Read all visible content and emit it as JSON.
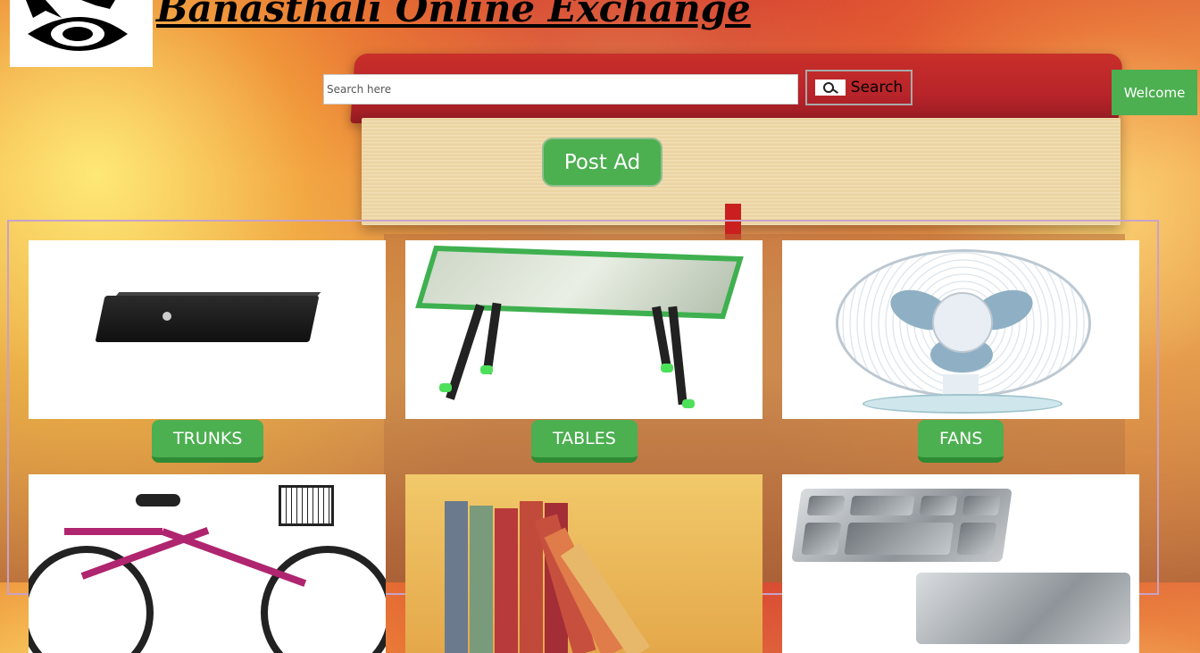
{
  "header": {
    "site_title": "Banasthali Online Exchange"
  },
  "search": {
    "placeholder": "Search here",
    "value": "",
    "button_label": "Search"
  },
  "user": {
    "welcome_label": "Welcome"
  },
  "actions": {
    "post_ad_label": "Post Ad"
  },
  "categories": [
    {
      "label": "TRUNKS"
    },
    {
      "label": "TABLES"
    },
    {
      "label": "FANS"
    },
    {
      "label": ""
    },
    {
      "label": ""
    },
    {
      "label": ""
    }
  ],
  "colors": {
    "accent_green": "#4caf50",
    "panel_border": "#c8a2c8"
  }
}
